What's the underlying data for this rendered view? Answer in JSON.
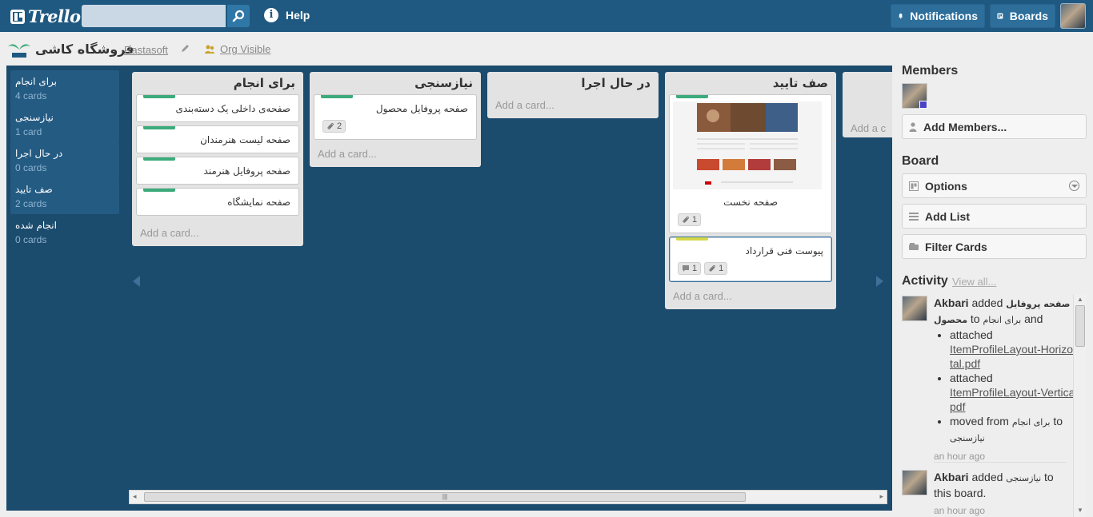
{
  "header": {
    "logo_text": "Trello",
    "search": {
      "value": "",
      "placeholder": ""
    },
    "help_label": "Help",
    "notifications_label": "Notifications",
    "boards_label": "Boards"
  },
  "board": {
    "title": "فروشگاه کاشی",
    "org": "Rastasoft",
    "visibility": "Org Visible"
  },
  "nav": [
    {
      "name": "برای انجام",
      "count": "4 cards"
    },
    {
      "name": "نیازسنجی",
      "count": "1 card"
    },
    {
      "name": "در حال اجرا",
      "count": "0 cards"
    },
    {
      "name": "صف تایید",
      "count": "2 cards"
    },
    {
      "name": "انجام شده",
      "count": "0 cards"
    }
  ],
  "lists": [
    {
      "title": "برای انجام",
      "cards": [
        {
          "title": "صفحه‌ی داخلی یک دسته‌بندی",
          "label_color": "#3cab7c"
        },
        {
          "title": "صفحه لیست هنرمندان",
          "label_color": "#3cab7c"
        },
        {
          "title": "صفحه پروفایل هنرمند",
          "label_color": "#3cab7c"
        },
        {
          "title": "صفحه نمایشگاه",
          "label_color": "#3cab7c"
        }
      ],
      "add_card": "Add a card..."
    },
    {
      "title": "نیازسنجی",
      "cards": [
        {
          "title": "صفحه پروفایل محصول",
          "label_color": "#3cab7c",
          "attachments": "2"
        }
      ],
      "add_card": "Add a card..."
    },
    {
      "title": "در حال اجرا",
      "cards": [],
      "add_card": "Add a card..."
    },
    {
      "title": "صف تایید",
      "cards": [
        {
          "title": "صفحه نخست",
          "label_color": "#3cab7c",
          "attachments": "1",
          "has_cover": true
        },
        {
          "title": "پیوست فنی قرارداد",
          "label_color": "#d6d84a",
          "comments": "1",
          "attachments": "1"
        }
      ],
      "add_card": "Add a card..."
    },
    {
      "add_card": "Add a c"
    }
  ],
  "sidebar": {
    "members_heading": "Members",
    "add_members": "Add Members...",
    "board_heading": "Board",
    "options": "Options",
    "add_list": "Add List",
    "filter_cards": "Filter Cards",
    "activity_heading": "Activity",
    "view_all": "View all...",
    "activity": [
      {
        "user": "Akbari",
        "verb": "added",
        "card": "صفحه پروفایل محصول",
        "to": "to",
        "list": "برای انجام",
        "and": "and",
        "items": [
          {
            "action": "attached",
            "file": "ItemProfileLayout-Horizontal.pdf"
          },
          {
            "action": "attached",
            "file": "ItemProfileLayout-Vertical.pdf"
          },
          {
            "action": "moved from",
            "from": "برای انجام",
            "to": "to",
            "dest": "نیازسنجی"
          }
        ],
        "time": "an hour ago"
      },
      {
        "user": "Akbari",
        "verb": "added",
        "list": "نیازسنجی",
        "to": "to",
        "rest": "this board.",
        "time": "an hour ago"
      }
    ]
  },
  "colors": {
    "header_bg": "#1f5981",
    "board_bg": "#1b4b6d",
    "label_green": "#3cab7c",
    "label_yellow": "#d6d84a"
  }
}
